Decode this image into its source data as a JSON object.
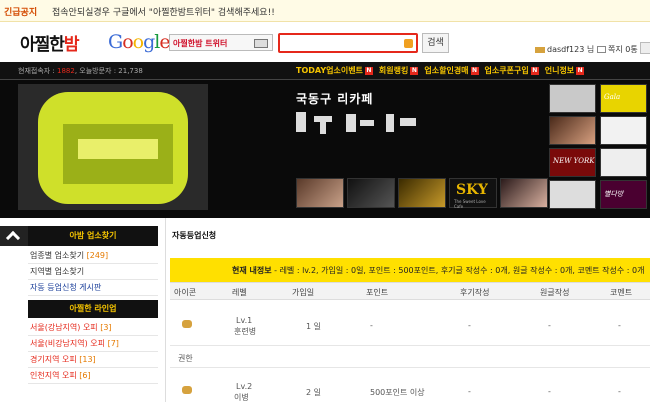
{
  "notice": {
    "label": "긴급공지",
    "text": "접속안되실경우 구글에서 \"아찔한밤트위터\" 검색해주세요!!"
  },
  "header": {
    "logo_text": "아찔한",
    "logo_accent": "밤",
    "google_letters": [
      {
        "ch": "G",
        "color": "#3b6bd6"
      },
      {
        "ch": "o",
        "color": "#d62d20"
      },
      {
        "ch": "o",
        "color": "#f4b400"
      },
      {
        "ch": "g",
        "color": "#3b6bd6"
      },
      {
        "ch": "l",
        "color": "#179a3e"
      },
      {
        "ch": "e",
        "color": "#d62d20"
      }
    ],
    "search_tag": "아찔한밤 트위터",
    "search_button": "검색",
    "user_label": "dasdf123 님",
    "message_label": "쪽지 0통"
  },
  "nav": {
    "stats_label_online": "현재접속자 : ",
    "stats_online": "1882",
    "stats_label_visitors": ", 오늘방문자 : 21,738",
    "menu": [
      {
        "label": "TODAY업소이벤트",
        "badge": "N"
      },
      {
        "label": "회원랭킹",
        "badge": "N"
      },
      {
        "label": "업소할인경매",
        "badge": "N"
      },
      {
        "label": "업소쿠폰구입",
        "badge": "N"
      },
      {
        "label": "언니정보",
        "badge": "N"
      }
    ]
  },
  "banner": {
    "cafe_title": "국동구 리카페",
    "sky_title": "SKY",
    "sky_sub": "The Sweet Love Cafe",
    "side_labels": [
      "Gala",
      "NEW YORK",
      "별다방"
    ]
  },
  "sidebar": {
    "section1": "아밤 업소찾기",
    "items1": [
      {
        "label": "업종별 업소찾기 ",
        "count": "[249]",
        "style": ""
      },
      {
        "label": "지역별 업소찾기",
        "count": "",
        "style": ""
      },
      {
        "label": "자동 등업신청 게시판",
        "count": "",
        "style": "blue"
      }
    ],
    "section2": "아찔한 라인업",
    "items2": [
      {
        "label": "서울(강남지역) 오피 ",
        "count": "[3]"
      },
      {
        "label": "서울(비강남지역) 오피 ",
        "count": "[7]"
      },
      {
        "label": "경기지역 오피 ",
        "count": "[13]"
      },
      {
        "label": "인천지역 오피 ",
        "count": "[6]"
      }
    ]
  },
  "content": {
    "title": "자동등업신청",
    "summary_prefix": "현재 내정보",
    "summary_rest": " - 레벨 : lv.2, 가입일 : 0일, 포인트 : 500포인트, 후기글 작성수 : 0개, 원글 작성수 : 0개, 코멘트 작성수 : 0개",
    "columns": [
      "아이콘",
      "레벨",
      "가입일",
      "포인트",
      "후기작성",
      "원글작성",
      "코멘트"
    ],
    "rows": [
      {
        "level": "Lv.1",
        "name": "훈련병",
        "join": "1 일",
        "points": "-",
        "review": "-",
        "post": "-",
        "comment": "-"
      },
      {
        "level": "Lv.2",
        "name": "이병",
        "join": "2 일",
        "points": "500포인트 이상",
        "review": "-",
        "post": "-",
        "comment": "-"
      }
    ],
    "section_label": "권한"
  }
}
